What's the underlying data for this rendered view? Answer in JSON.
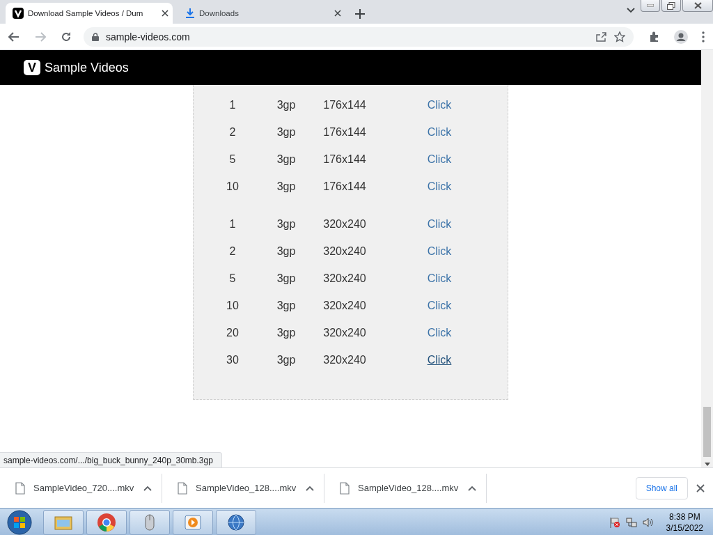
{
  "browser": {
    "tabs": [
      {
        "title": "Download Sample Videos / Dum",
        "kind": "site",
        "selected": true
      },
      {
        "title": "Downloads",
        "kind": "download",
        "selected": false
      }
    ],
    "address": "sample-videos.com"
  },
  "site": {
    "brand_letter": "V",
    "brand_name": "Sample Videos"
  },
  "table": {
    "groups": [
      {
        "rows": [
          {
            "size": "1",
            "format": "3gp",
            "resolution": "176x144",
            "link": "Click",
            "hovered": false
          },
          {
            "size": "2",
            "format": "3gp",
            "resolution": "176x144",
            "link": "Click",
            "hovered": false
          },
          {
            "size": "5",
            "format": "3gp",
            "resolution": "176x144",
            "link": "Click",
            "hovered": false
          },
          {
            "size": "10",
            "format": "3gp",
            "resolution": "176x144",
            "link": "Click",
            "hovered": false
          }
        ]
      },
      {
        "rows": [
          {
            "size": "1",
            "format": "3gp",
            "resolution": "320x240",
            "link": "Click",
            "hovered": false
          },
          {
            "size": "2",
            "format": "3gp",
            "resolution": "320x240",
            "link": "Click",
            "hovered": false
          },
          {
            "size": "5",
            "format": "3gp",
            "resolution": "320x240",
            "link": "Click",
            "hovered": false
          },
          {
            "size": "10",
            "format": "3gp",
            "resolution": "320x240",
            "link": "Click",
            "hovered": false
          },
          {
            "size": "20",
            "format": "3gp",
            "resolution": "320x240",
            "link": "Click",
            "hovered": false
          },
          {
            "size": "30",
            "format": "3gp",
            "resolution": "320x240",
            "link": "Click",
            "hovered": true
          }
        ]
      }
    ]
  },
  "status_bubble": "sample-videos.com/.../big_buck_bunny_240p_30mb.3gp",
  "downloads": {
    "items": [
      {
        "name": "SampleVideo_720....mkv"
      },
      {
        "name": "SampleVideo_128....mkv"
      },
      {
        "name": "SampleVideo_128....mkv"
      }
    ],
    "show_all": "Show all"
  },
  "taskbar": {
    "time": "8:38 PM",
    "date": "3/15/2022"
  }
}
